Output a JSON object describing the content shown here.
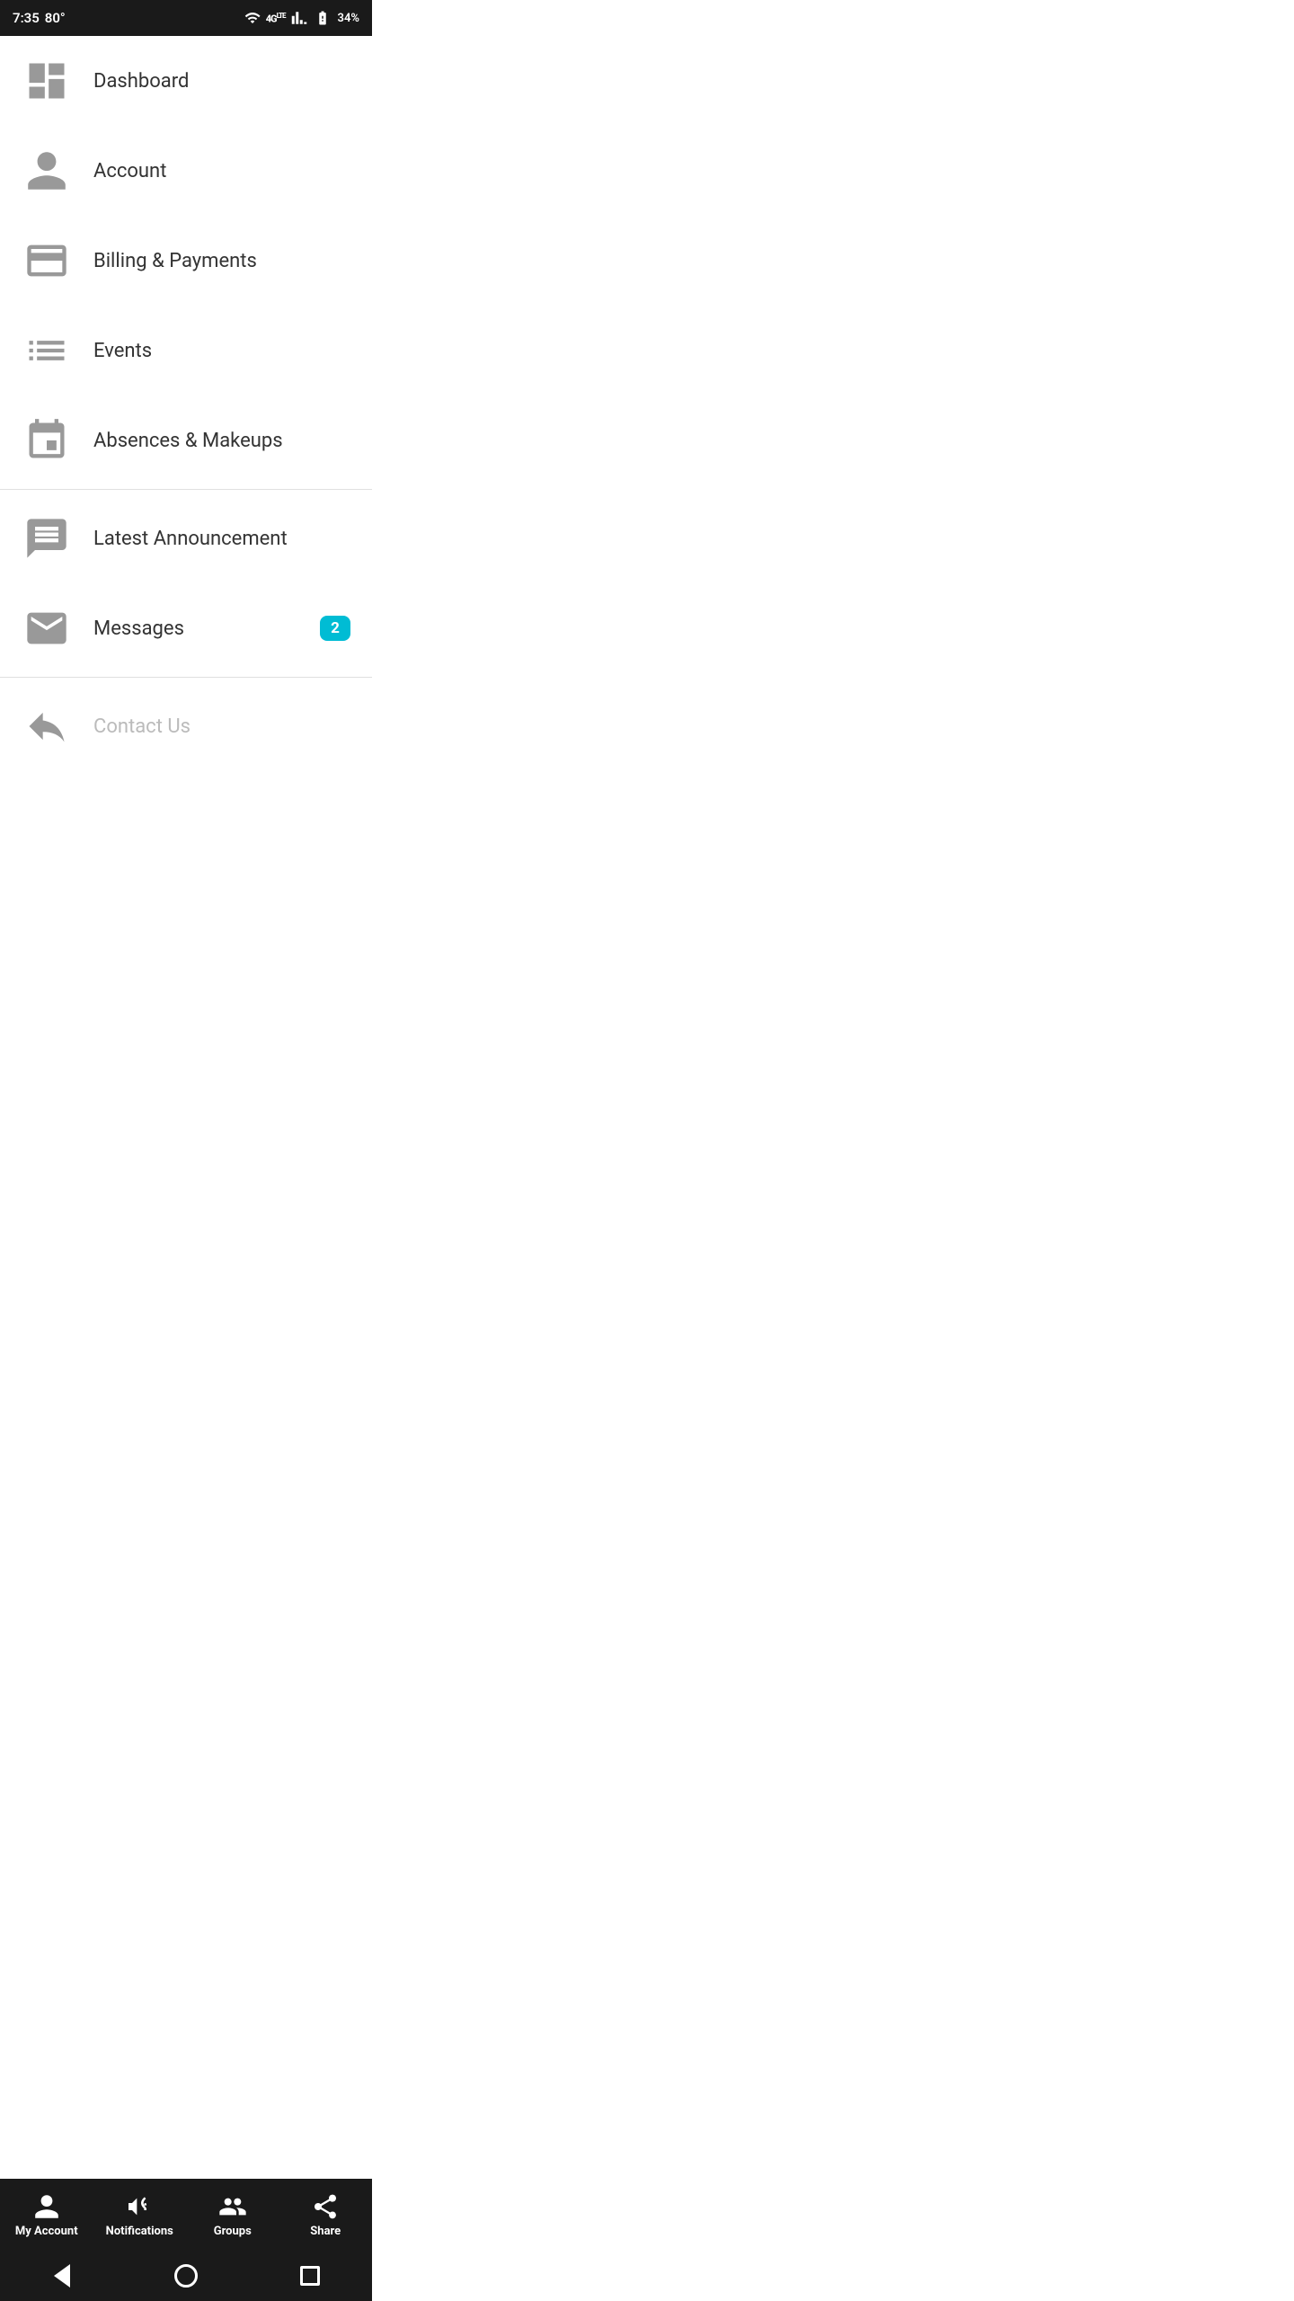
{
  "statusBar": {
    "time": "7:35",
    "temp": "80°",
    "battery": "34%"
  },
  "menuItems": [
    {
      "id": "dashboard",
      "label": "Dashboard",
      "icon": "dashboard-icon",
      "badge": null
    },
    {
      "id": "account",
      "label": "Account",
      "icon": "account-icon",
      "badge": null
    },
    {
      "id": "billing",
      "label": "Billing & Payments",
      "icon": "billing-icon",
      "badge": null
    },
    {
      "id": "events",
      "label": "Events",
      "icon": "events-icon",
      "badge": null
    },
    {
      "id": "absences",
      "label": "Absences & Makeups",
      "icon": "absences-icon",
      "badge": null
    }
  ],
  "menuItems2": [
    {
      "id": "announcement",
      "label": "Latest Announcement",
      "icon": "announcement-icon",
      "badge": null
    },
    {
      "id": "messages",
      "label": "Messages",
      "icon": "messages-icon",
      "badge": "2"
    }
  ],
  "menuItems3": [
    {
      "id": "contact",
      "label": "Contact Us",
      "icon": "contact-icon",
      "badge": null
    }
  ],
  "bottomNav": [
    {
      "id": "my-account",
      "label": "My Account",
      "icon": "person-icon"
    },
    {
      "id": "notifications",
      "label": "Notifications",
      "icon": "megaphone-icon"
    },
    {
      "id": "groups",
      "label": "Groups",
      "icon": "groups-icon"
    },
    {
      "id": "share",
      "label": "Share",
      "icon": "share-icon"
    }
  ],
  "accentColor": "#00bcd4"
}
